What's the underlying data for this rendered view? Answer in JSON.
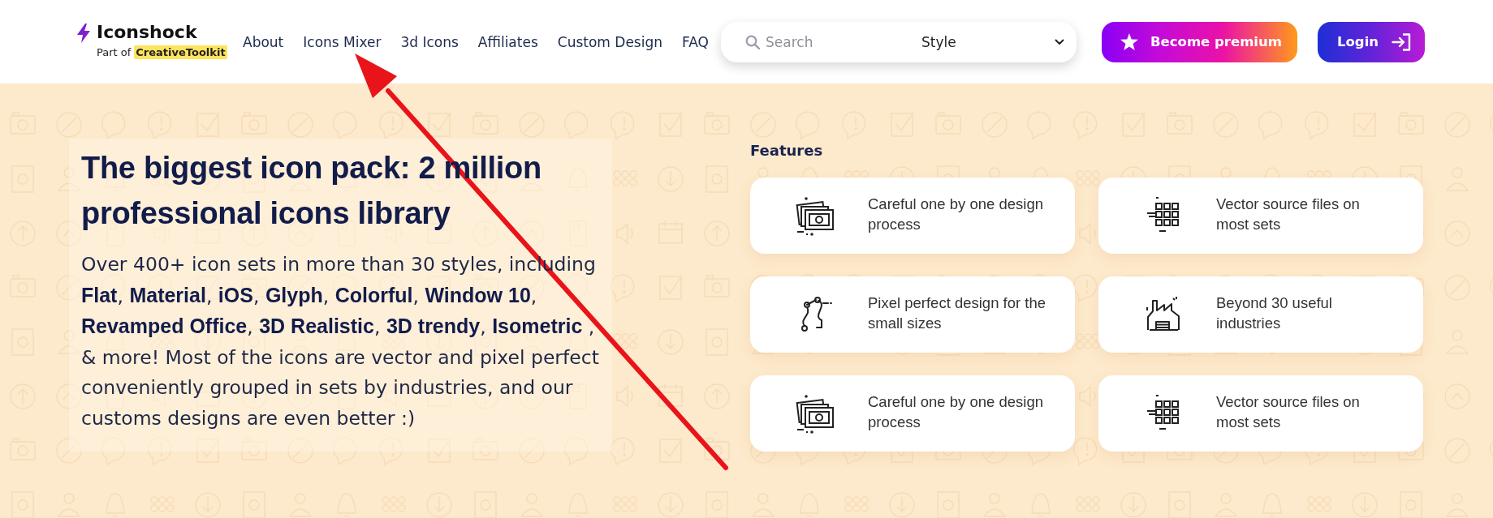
{
  "header": {
    "logo": {
      "name": "Iconshock",
      "tagline": "Part of",
      "tagline_brand": "CreativeToolkit"
    },
    "nav": [
      "About",
      "Icons Mixer",
      "3d Icons",
      "Affiliates",
      "Custom Design",
      "FAQ"
    ],
    "search": {
      "placeholder": "Search",
      "style_filter": "Style"
    },
    "buttons": [
      {
        "kind": "premium",
        "label": "Become premium"
      },
      {
        "kind": "login",
        "label": "Login"
      }
    ]
  },
  "hero": {
    "heading": "The biggest icon pack: 2 million professional icons library",
    "description": "Over 400+ icon sets in more than 30 styles, including **Flat**, **Material**, **iOS**, **Glyph**, **Colorful**, **Window 10**, **Revamped Office**, **3D Realistic**, **3D trendy**, **Isometric** , & more! Most of the icons are vector and pixel perfect conveniently grouped in sets by industries, and our customs designs are even better :)"
  },
  "features": {
    "title": "Features",
    "items": [
      {
        "kind": "photo-stack",
        "text": "Careful one by one design process"
      },
      {
        "kind": "grid",
        "text": "Vector source files on most sets"
      },
      {
        "kind": "bezier",
        "text": "Pixel perfect design for the small sizes"
      },
      {
        "kind": "factory",
        "text": "Beyond 30 useful industries"
      },
      {
        "kind": "photo-stack",
        "text": "Careful one by one design process"
      },
      {
        "kind": "grid",
        "text": "Vector source files on most sets"
      }
    ]
  },
  "annotations": [
    {
      "kind": "arrow"
    }
  ]
}
